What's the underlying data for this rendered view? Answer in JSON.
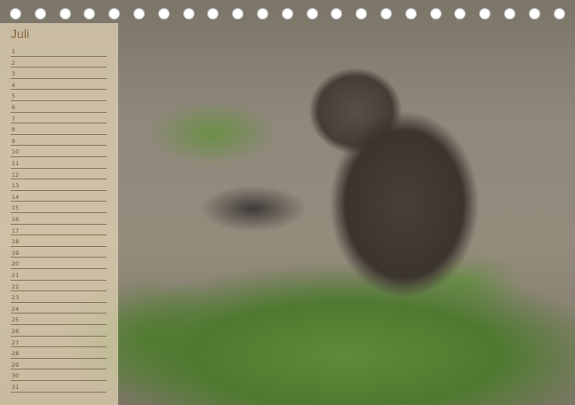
{
  "calendar": {
    "month": "Juli",
    "days": [
      "1",
      "2",
      "3",
      "4",
      "5",
      "6",
      "7",
      "8",
      "9",
      "10",
      "11",
      "12",
      "13",
      "14",
      "15",
      "16",
      "17",
      "18",
      "19",
      "20",
      "21",
      "22",
      "23",
      "24",
      "25",
      "26",
      "27",
      "28",
      "29",
      "30",
      "31"
    ]
  },
  "binding": {
    "hole_count": 23
  },
  "colors": {
    "panel": "#e5d5b7",
    "month_text": "#8a6a3a",
    "line": "#8c7657"
  }
}
